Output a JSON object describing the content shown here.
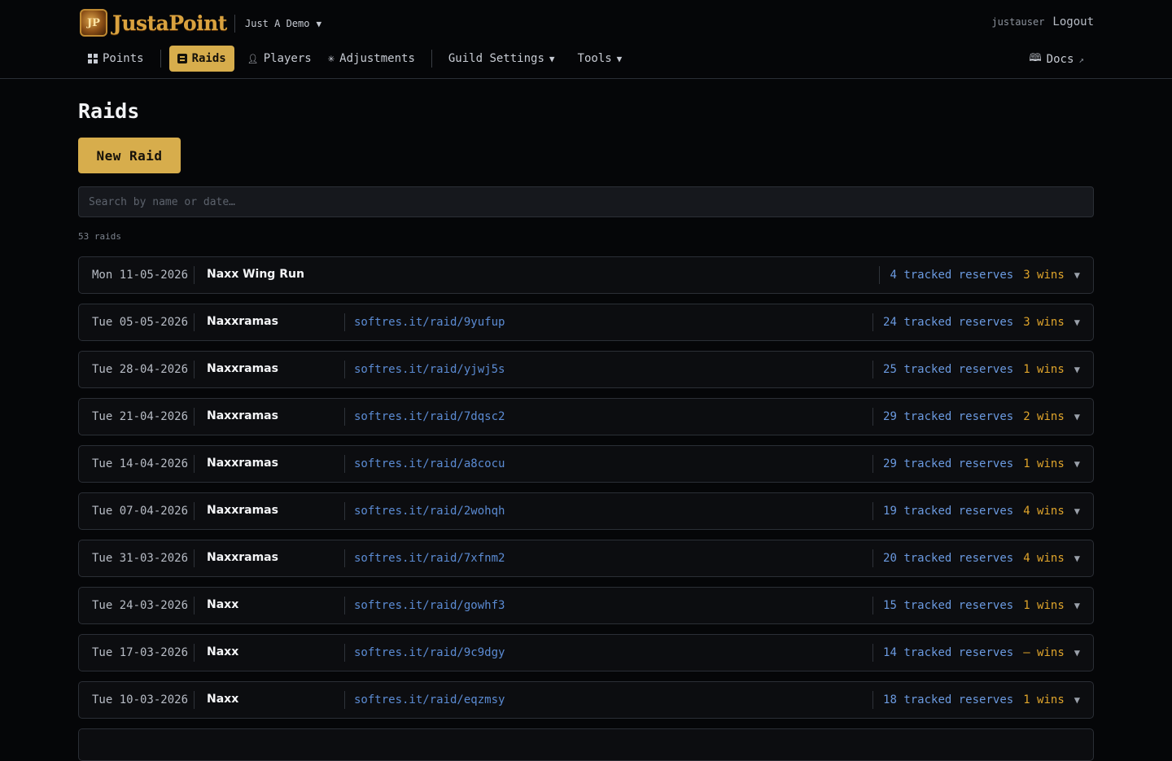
{
  "brand": {
    "logo_text": "JustaPoint",
    "logo_glyph": "JP"
  },
  "guild": {
    "name": "Just A Demo"
  },
  "user": {
    "username": "justauser",
    "logout_label": "Logout"
  },
  "nav": {
    "points": "Points",
    "raids": "Raids",
    "players": "Players",
    "adjustments": "Adjustments",
    "guild_settings": "Guild Settings",
    "tools": "Tools",
    "docs": "Docs"
  },
  "icons": {
    "points": "grid-icon",
    "raids": "raids-icon",
    "players": "person-icon",
    "adjustments": "sparkle-icon",
    "docs": "book-icon",
    "external": "external-link-icon",
    "dropdown": "caret-down-icon"
  },
  "page": {
    "title": "Raids",
    "new_raid_label": "New Raid",
    "search_placeholder": "Search by name or date…",
    "count_text": "53 raids"
  },
  "colors": {
    "accent": "#d7ad4c",
    "link": "#5b8bd3",
    "reserves": "#6b9ae0",
    "wins": "#e0a52b"
  },
  "raids": [
    {
      "date": "Mon 11-05-2026",
      "name": "Naxx Wing Run",
      "link": "",
      "reserves": "4 tracked reserves",
      "wins": "3 wins"
    },
    {
      "date": "Tue 05-05-2026",
      "name": "Naxxramas",
      "link": "softres.it/raid/9yufup",
      "reserves": "24 tracked reserves",
      "wins": "3 wins"
    },
    {
      "date": "Tue 28-04-2026",
      "name": "Naxxramas",
      "link": "softres.it/raid/yjwj5s",
      "reserves": "25 tracked reserves",
      "wins": "1 wins"
    },
    {
      "date": "Tue 21-04-2026",
      "name": "Naxxramas",
      "link": "softres.it/raid/7dqsc2",
      "reserves": "29 tracked reserves",
      "wins": "2 wins"
    },
    {
      "date": "Tue 14-04-2026",
      "name": "Naxxramas",
      "link": "softres.it/raid/a8cocu",
      "reserves": "29 tracked reserves",
      "wins": "1 wins"
    },
    {
      "date": "Tue 07-04-2026",
      "name": "Naxxramas",
      "link": "softres.it/raid/2wohqh",
      "reserves": "19 tracked reserves",
      "wins": "4 wins"
    },
    {
      "date": "Tue 31-03-2026",
      "name": "Naxxramas",
      "link": "softres.it/raid/7xfnm2",
      "reserves": "20 tracked reserves",
      "wins": "4 wins"
    },
    {
      "date": "Tue 24-03-2026",
      "name": "Naxx",
      "link": "softres.it/raid/gowhf3",
      "reserves": "15 tracked reserves",
      "wins": "1 wins"
    },
    {
      "date": "Tue 17-03-2026",
      "name": "Naxx",
      "link": "softres.it/raid/9c9dgy",
      "reserves": "14 tracked reserves",
      "wins": "— wins"
    },
    {
      "date": "Tue 10-03-2026",
      "name": "Naxx",
      "link": "softres.it/raid/eqzmsy",
      "reserves": "18 tracked reserves",
      "wins": "1 wins"
    }
  ]
}
